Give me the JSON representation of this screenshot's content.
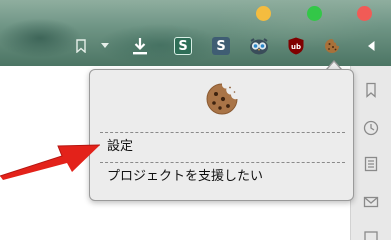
{
  "window": {
    "traffic_lights": [
      "minimize",
      "zoom",
      "close"
    ]
  },
  "toolbar": {
    "extensions": [
      {
        "name": "S",
        "color": "#2e6e57"
      },
      {
        "name": "S",
        "color": "#3f5d73"
      },
      {
        "name": "uBlock Origin",
        "label": "ub",
        "color": "#800000"
      }
    ]
  },
  "popup": {
    "menu": [
      {
        "label": "設定"
      },
      {
        "label": "プロジェクトを支援したい"
      }
    ]
  },
  "annotation": {
    "color": "#e3221a"
  }
}
